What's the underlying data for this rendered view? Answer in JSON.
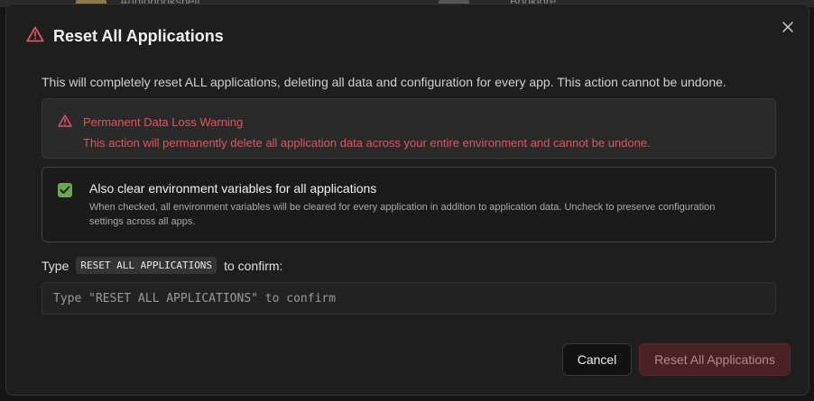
{
  "background": {
    "left_app_label": "Audiobookshelf",
    "right_app_label": "Booklore"
  },
  "dialog": {
    "title": "Reset All Applications",
    "title_icon": "warning-triangle-icon",
    "close_icon": "close-icon",
    "description": "This will completely reset ALL applications, deleting all data and configuration for every app. This action cannot be undone.",
    "warning": {
      "icon": "warning-triangle-icon",
      "title": "Permanent Data Loss Warning",
      "text": "This action will permanently delete all application data across your entire environment and cannot be undone."
    },
    "env_option": {
      "checked": true,
      "label": "Also clear environment variables for all applications",
      "help": "When checked, all environment variables will be cleared for every application in addition to application data. Uncheck to preserve configuration settings across all apps."
    },
    "confirm": {
      "prefix": "Type",
      "code": "RESET ALL APPLICATIONS",
      "suffix": "to confirm:",
      "value": "",
      "placeholder": "Type \"RESET ALL APPLICATIONS\" to confirm"
    },
    "buttons": {
      "cancel": "Cancel",
      "reset": "Reset All Applications"
    }
  },
  "colors": {
    "danger": "#e0555a",
    "checkbox": "#6aa84f",
    "reset_button_bg": "#4a2226"
  }
}
